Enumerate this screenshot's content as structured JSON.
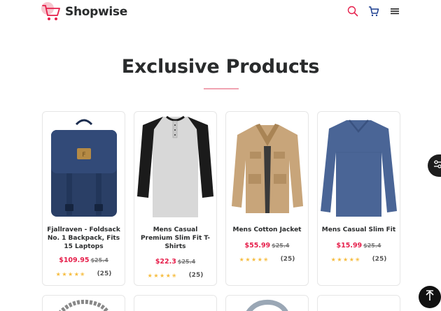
{
  "header": {
    "brand": "Shopwise",
    "icons": [
      "search-icon",
      "cart-icon",
      "menu-icon"
    ]
  },
  "section": {
    "title": "Exclusive Products"
  },
  "products": [
    {
      "name": "Fjallraven - Foldsack No. 1 Backpack, Fits 15 Laptops",
      "price": "$109.95",
      "old_price": "$25.4",
      "rating_stars": 4.5,
      "review_count": "(25)"
    },
    {
      "name": "Mens Casual Premium Slim Fit T-Shirts",
      "price": "$22.3",
      "old_price": "$25.4",
      "rating_stars": 4.5,
      "review_count": "(25)"
    },
    {
      "name": "Mens Cotton Jacket",
      "price": "$55.99",
      "old_price": "$25.4",
      "rating_stars": 4.5,
      "review_count": "(25)"
    },
    {
      "name": "Mens Casual Slim Fit",
      "price": "$15.99",
      "old_price": "$25.4",
      "rating_stars": 4.5,
      "review_count": "(25)"
    }
  ],
  "colors": {
    "accent": "#e61f4b",
    "star": "#f6bc3e",
    "title_underline": "#f0a3b1"
  }
}
